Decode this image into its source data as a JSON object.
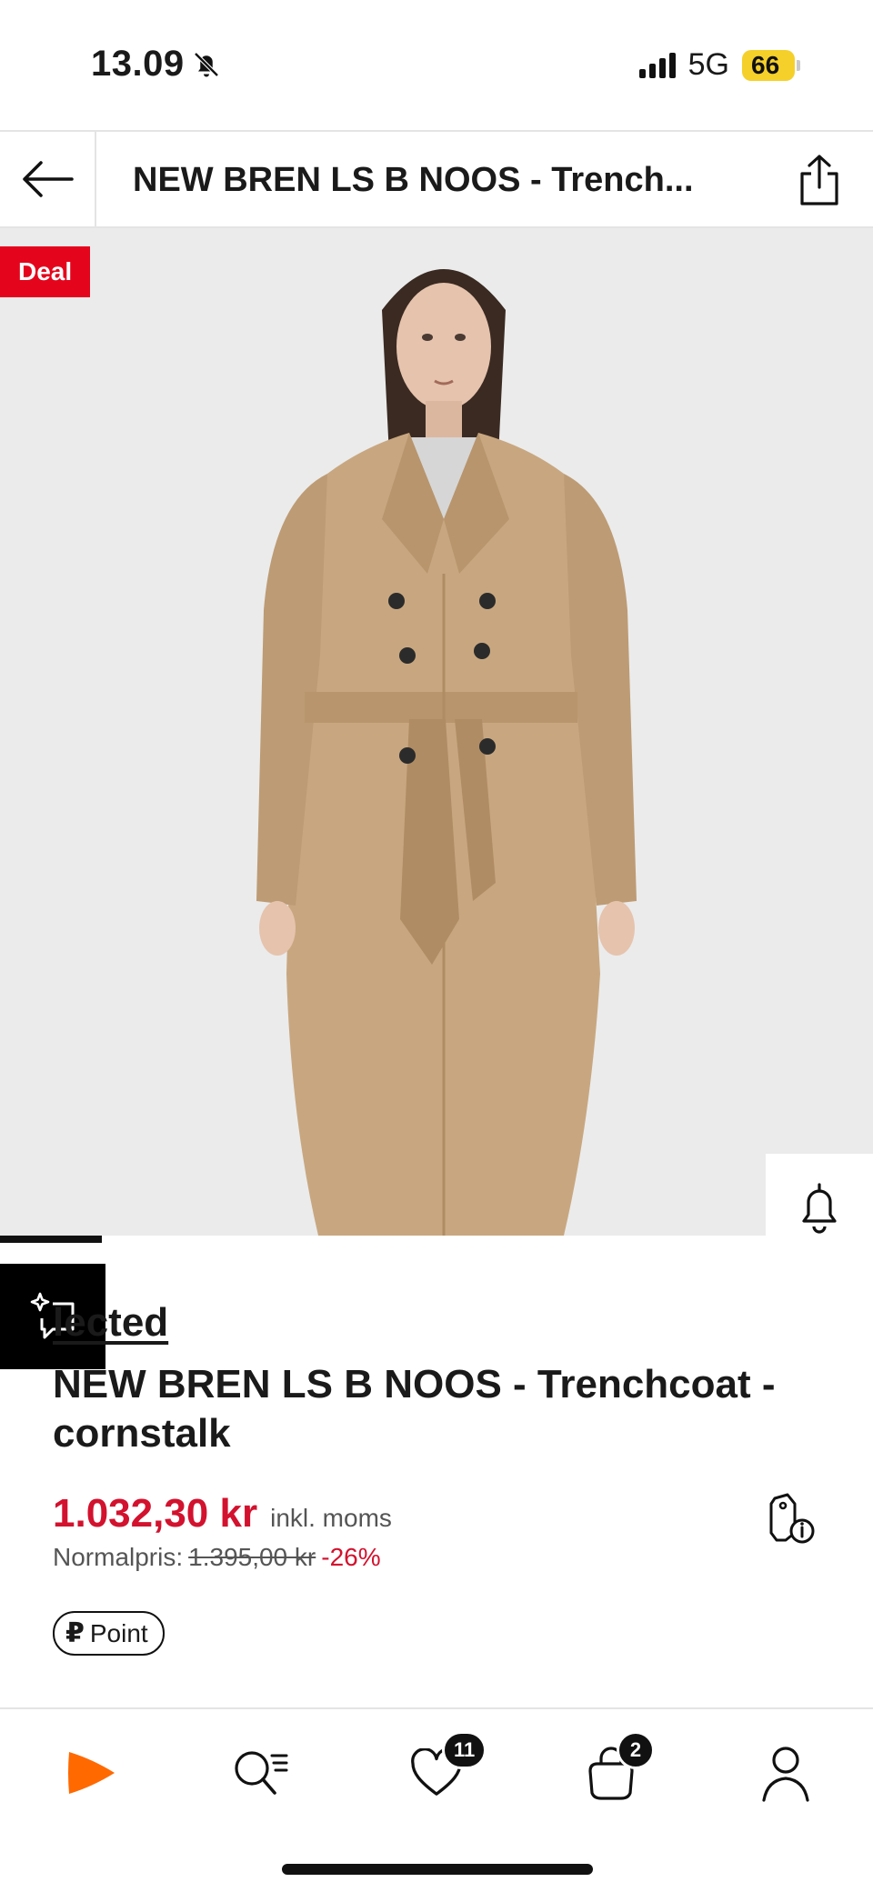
{
  "status": {
    "time": "13.09",
    "network": "5G",
    "battery": "66"
  },
  "header": {
    "title": "NEW BREN LS B NOOS - Trench..."
  },
  "hero": {
    "deal_label": "Deal"
  },
  "product": {
    "brand": "lected",
    "name": "NEW BREN LS B NOOS - Trenchcoat - cornstalk",
    "price": "1.032,30 kr",
    "vat": "inkl. moms",
    "normal_label": "Normalpris:",
    "normal_price": "1.395,00 kr",
    "discount": "-26%",
    "point_label": "Point"
  },
  "nav_badges": {
    "wishlist": "11",
    "bag": "2"
  },
  "colors": {
    "accent": "#ff6900",
    "sale": "#d2122e",
    "deal": "#e4051c",
    "coat": "#c7a67f"
  }
}
